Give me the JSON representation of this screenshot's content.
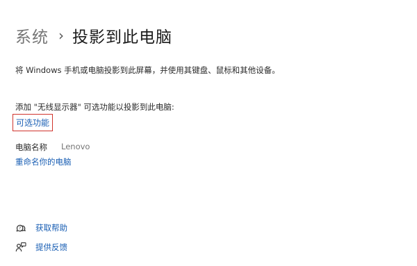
{
  "breadcrumb": {
    "parent": "系统",
    "separator": "›",
    "current": "投影到此电脑"
  },
  "description": "将 Windows 手机或电脑投影到此屏幕，并使用其键盘、鼠标和其他设备。",
  "add_feature_text": "添加 \"无线显示器\" 可选功能以投影到此电脑:",
  "optional_features_link": "可选功能",
  "pc_name": {
    "label": "电脑名称",
    "value": "Lenovo"
  },
  "rename_link": "重命名你的电脑",
  "footer": {
    "get_help": "获取帮助",
    "give_feedback": "提供反馈"
  },
  "icons": {
    "help": "help-icon",
    "feedback": "feedback-icon"
  },
  "colors": {
    "link": "#1a5fb4",
    "highlight_border": "#d0342c"
  }
}
